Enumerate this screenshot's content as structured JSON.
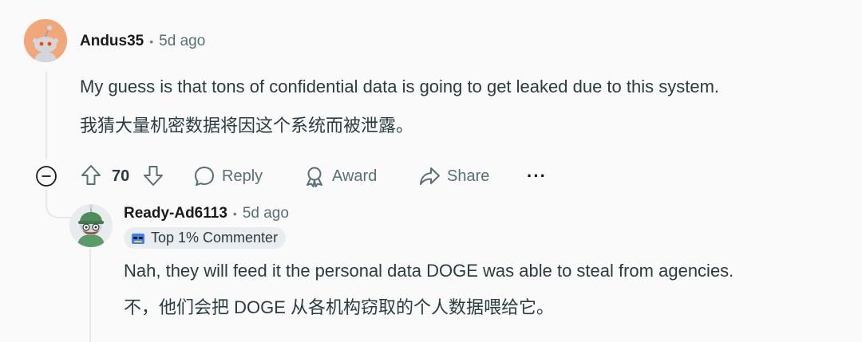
{
  "comment": {
    "author": "Andus35",
    "separator": "•",
    "time": "5d ago",
    "text_en": "My guess is that tons of confidential data is going to get leaked due to this system.",
    "text_zh": "我猜大量机密数据将因这个系统而被泄露。",
    "actions": {
      "votes": "70",
      "reply_label": "Reply",
      "award_label": "Award",
      "share_label": "Share",
      "more_label": "···"
    }
  },
  "reply": {
    "author": "Ready-Ad6113",
    "separator": "•",
    "time": "5d ago",
    "badge": "Top 1% Commenter",
    "text_en": "Nah, they will feed it the personal data DOGE was able to steal from agencies.",
    "text_zh": "不，他们会把 DOGE 从各机构窃取的个人数据喂给它。"
  },
  "colors": {
    "background": "#fafafa",
    "text": "#2a3c42",
    "muted": "#576f76",
    "thread": "#e5e8ea",
    "avatar1": "#f0a87a"
  }
}
